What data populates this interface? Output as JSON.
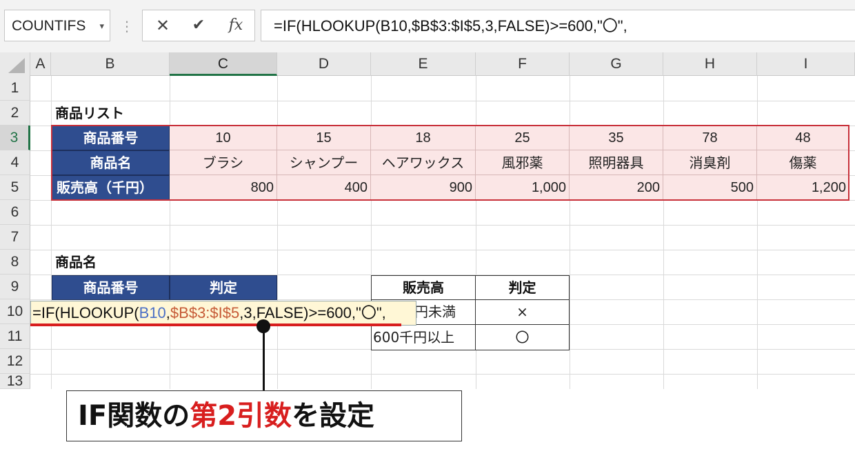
{
  "formula_bar": {
    "name_box": "COUNTIFS",
    "name_box_dropdown": "▾",
    "separator": "⋮",
    "cancel_icon": "✕",
    "enter_icon": "✔",
    "fx_label": "fx",
    "formula": "=IF(HLOOKUP(B10,$B$3:$I$5,3,FALSE)>=600,\"〇\","
  },
  "columns": [
    "A",
    "B",
    "C",
    "D",
    "E",
    "F",
    "G",
    "H",
    "I"
  ],
  "selected_column": "C",
  "rows": [
    "1",
    "2",
    "3",
    "4",
    "5",
    "6",
    "7",
    "8",
    "9",
    "10",
    "11",
    "12",
    "13"
  ],
  "selected_rows": [
    "3",
    "10"
  ],
  "product_list": {
    "title": "商品リスト",
    "row_headers": [
      "商品番号",
      "商品名",
      "販売高（千円）"
    ],
    "numbers": [
      "10",
      "15",
      "18",
      "25",
      "35",
      "78",
      "48"
    ],
    "names": [
      "ブラシ",
      "シャンプー",
      "ヘアワックス",
      "風邪薬",
      "照明器具",
      "消臭剤",
      "傷薬"
    ],
    "sales": [
      "800",
      "400",
      "900",
      "1,000",
      "200",
      "500",
      "1,200"
    ]
  },
  "lookup": {
    "title": "商品名",
    "col1": "商品番号",
    "col2": "判定"
  },
  "editing": {
    "prefix": "=IF(HLOOKUP(",
    "ref1": "B10",
    "comma1": ",",
    "ref2": "$B$3:$I$5",
    "rest": ",3,FALSE)>=600,\"〇\","
  },
  "criteria": {
    "header_sales": "販売高",
    "header_judge": "判定",
    "row1_sales": "円未満",
    "row1_judge": "×",
    "row2_sales": "600千円以上",
    "row2_judge": "〇"
  },
  "callout": {
    "part1": "IF関数の",
    "part2": "第2引数",
    "part3": "を設定"
  },
  "colors": {
    "header_blue": "#2f4d8f",
    "pink_fill": "#fbe6e6",
    "selection_red": "#c8303a",
    "excel_green": "#217346",
    "emphasis_red": "#d81e1e"
  }
}
